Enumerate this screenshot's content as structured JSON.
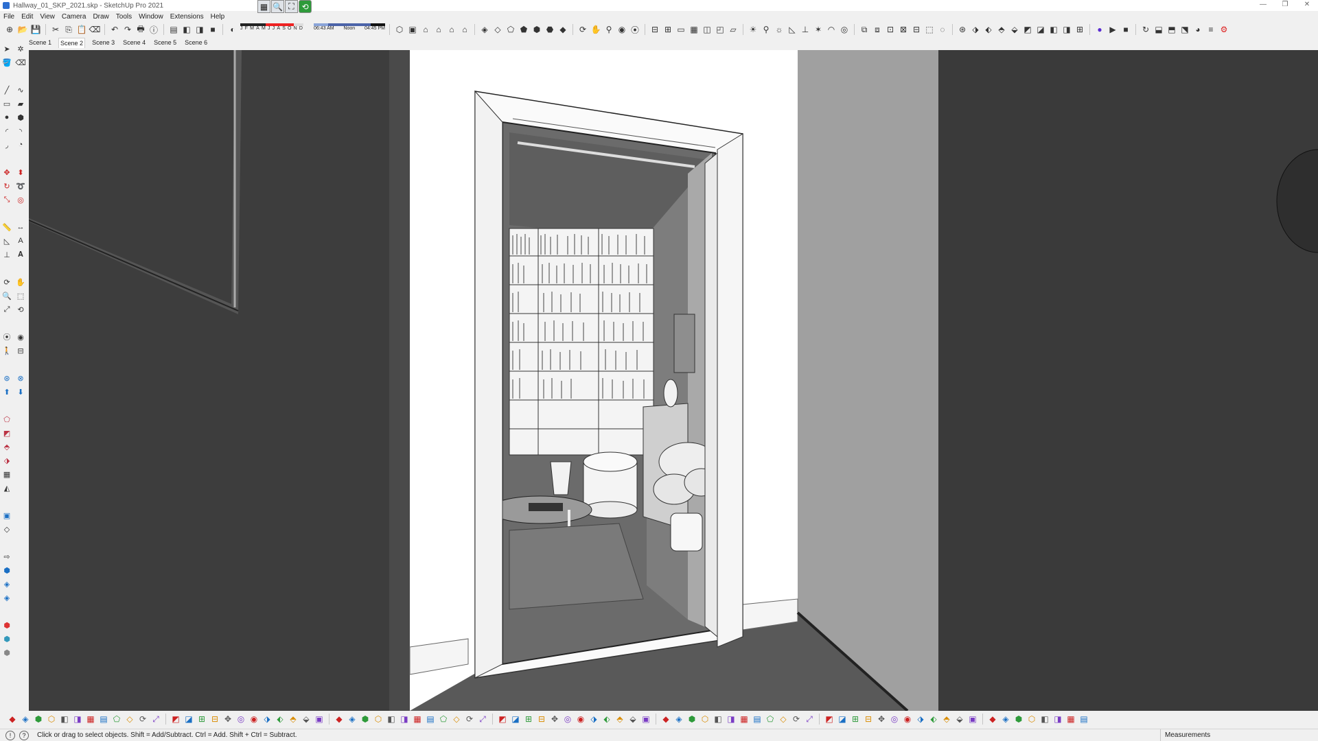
{
  "window": {
    "title": "Hallway_01_SKP_2021.skp - SketchUp Pro 2021"
  },
  "menu": [
    "File",
    "Edit",
    "View",
    "Camera",
    "Draw",
    "Tools",
    "Window",
    "Extensions",
    "Help"
  ],
  "shadow": {
    "months": [
      "J",
      "F",
      "M",
      "A",
      "M",
      "J",
      "J",
      "A",
      "S",
      "O",
      "N",
      "D"
    ],
    "time_start": "06:43 AM",
    "time_mid": "Noon",
    "time_end": "04:45 PM"
  },
  "scenes": {
    "items": [
      "Scene 1",
      "Scene 2",
      "Scene 3",
      "Scene 4",
      "Scene 5",
      "Scene 6"
    ],
    "active_index": 1
  },
  "status": {
    "hint": "Click or drag to select objects. Shift = Add/Subtract. Ctrl = Add. Shift + Ctrl = Subtract.",
    "measurements_label": "Measurements"
  },
  "icons": {
    "top": [
      "new-icon",
      "open-icon",
      "save-icon",
      "cut-icon",
      "copy-icon",
      "paste-icon",
      "erase-icon",
      "undo-icon",
      "redo-icon",
      "print-icon",
      "model-info-icon",
      "outliner-icon",
      "components-icon",
      "dimension-icon",
      "materials-icon",
      "eraser-icon"
    ],
    "bottom_count": 80
  }
}
